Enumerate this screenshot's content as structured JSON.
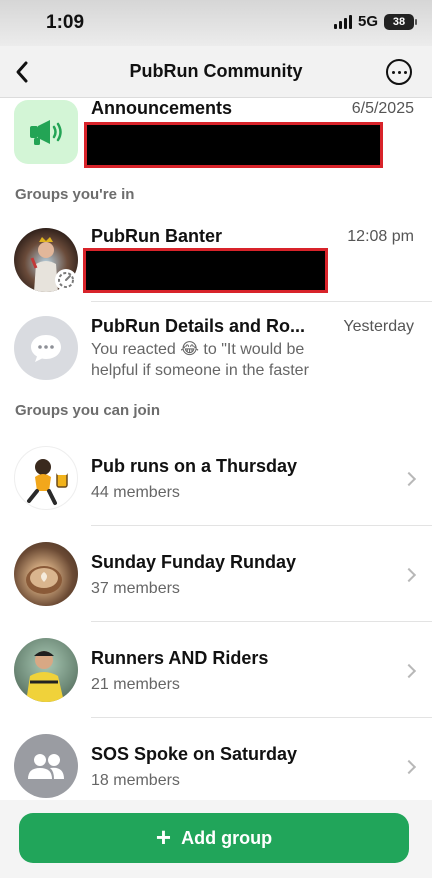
{
  "status": {
    "time": "1:09",
    "network": "5G",
    "battery": "38"
  },
  "nav": {
    "title": "PubRun Community",
    "back_icon": "chevron-left-icon",
    "more_icon": "ellipsis-circle-icon"
  },
  "announcements": {
    "title": "Announcements",
    "date": "6/5/2025",
    "icon": "megaphone-icon"
  },
  "sections": {
    "groups_in": "Groups you're in",
    "groups_join": "Groups you can join"
  },
  "groups_in": [
    {
      "title": "PubRun Banter",
      "time": "12:08 pm"
    },
    {
      "title": "PubRun Details and Ro...",
      "time": "Yesterday",
      "preview_prefix": "You reacted",
      "preview_emoji": "😂",
      "preview_suffix": "to \"It would be helpful if someone in the faster"
    }
  ],
  "groups_join": [
    {
      "title": "Pub runs on a Thursday",
      "members": "44 members"
    },
    {
      "title": "Sunday Funday Runday",
      "members": "37 members"
    },
    {
      "title": "Runners AND Riders",
      "members": "21 members"
    },
    {
      "title": "SOS Spoke on Saturday",
      "members": "18 members"
    }
  ],
  "actions": {
    "add_group": "Add group"
  },
  "colors": {
    "accent": "#21a55a",
    "announcement_bg": "#d3f5d6",
    "redaction_border": "#d8232a"
  }
}
